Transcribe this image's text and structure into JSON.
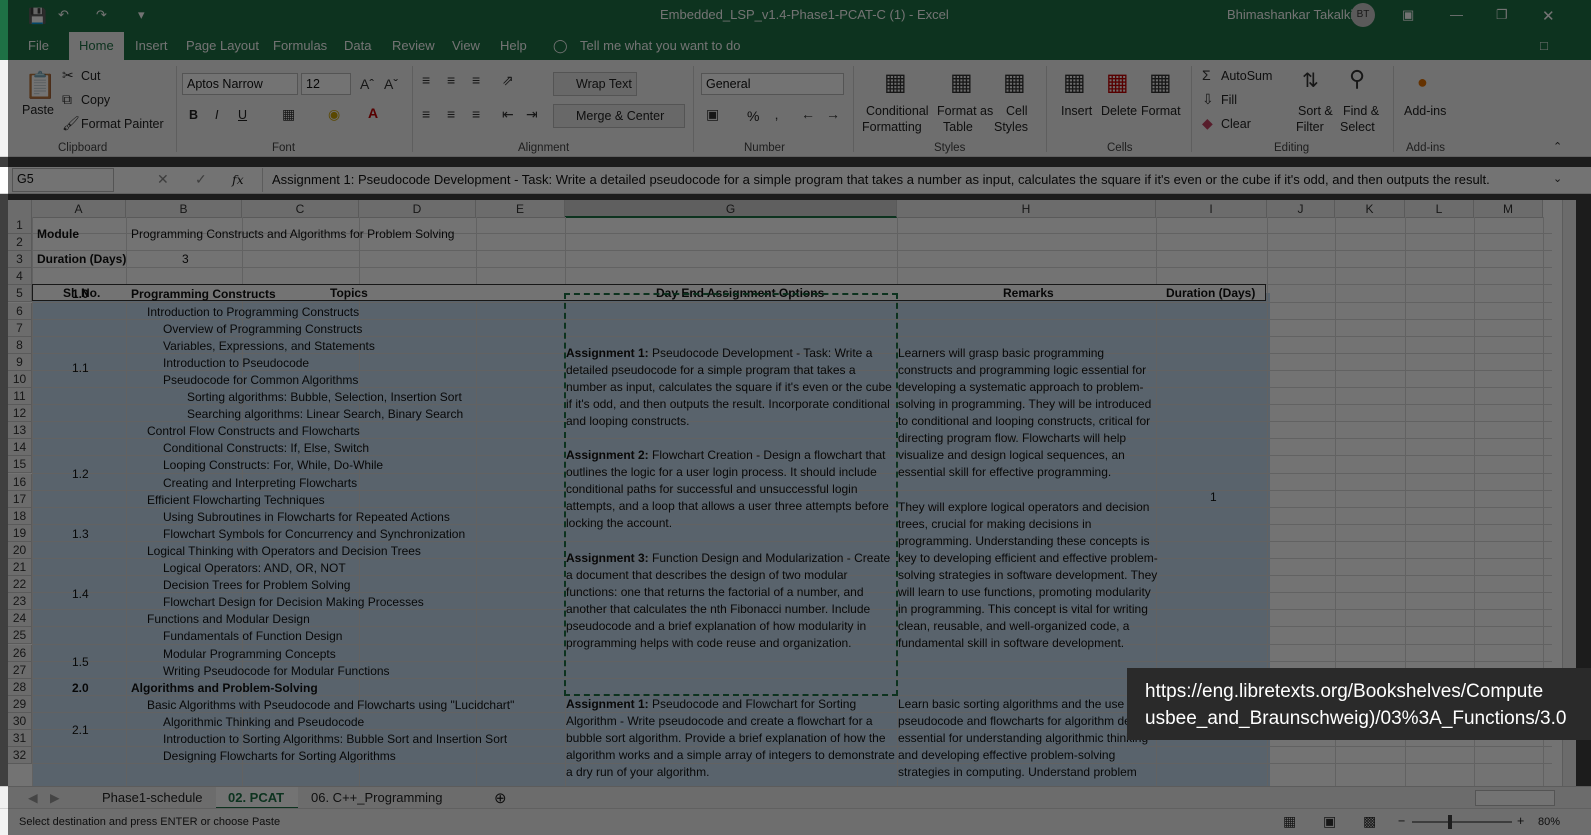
{
  "title_bar": {
    "doc_title": "Embedded_LSP_v1.4-Phase1-PCAT-C (1)  -  Excel",
    "user": "Bhimashankar Takalki",
    "initials": "BT"
  },
  "menu": {
    "file": "File",
    "home": "Home",
    "insert": "Insert",
    "page_layout": "Page Layout",
    "formulas": "Formulas",
    "data": "Data",
    "review": "Review",
    "view": "View",
    "help": "Help",
    "tell_me": "Tell me what you want to do"
  },
  "ribbon": {
    "clipboard": {
      "paste": "Paste",
      "cut": "Cut",
      "copy": "Copy",
      "format_painter": "Format Painter",
      "group": "Clipboard"
    },
    "font": {
      "name": "Aptos Narrow",
      "size": "12",
      "group": "Font",
      "bold": "B",
      "italic": "I",
      "underline": "U"
    },
    "alignment": {
      "wrap": "Wrap Text",
      "merge": "Merge & Center",
      "group": "Alignment"
    },
    "number": {
      "format": "General",
      "group": "Number",
      "percent": "%"
    },
    "styles": {
      "cond1": "Conditional",
      "cond2": "Formatting",
      "fmt1": "Format as",
      "fmt2": "Table",
      "cell1": "Cell",
      "cell2": "Styles",
      "group": "Styles"
    },
    "cells": {
      "insert": "Insert",
      "delete": "Delete",
      "format": "Format",
      "group": "Cells"
    },
    "editing": {
      "autosum": "AutoSum",
      "fill": "Fill",
      "clear": "Clear",
      "sort1": "Sort &",
      "sort2": "Filter",
      "find1": "Find &",
      "find2": "Select",
      "group": "Editing"
    },
    "addins": {
      "label": "Add-ins",
      "group": "Add-ins"
    }
  },
  "formula_bar": {
    "name_box": "G5",
    "fx": "fx",
    "content": "Assignment 1: Pseudocode Development - Task: Write a detailed pseudocode for a simple program that takes a number as input, calculates the square if it's even or the cube if it's odd, and then outputs the result."
  },
  "columns": [
    "A",
    "B",
    "C",
    "D",
    "E",
    "G",
    "H",
    "I",
    "J",
    "K",
    "L",
    "M"
  ],
  "rows": [
    "1",
    "2",
    "3",
    "4",
    "5",
    "6",
    "7",
    "8",
    "9",
    "10",
    "11",
    "12",
    "13",
    "14",
    "15",
    "16",
    "17",
    "18",
    "19",
    "20",
    "21",
    "22",
    "23",
    "24",
    "25",
    "26",
    "27",
    "28",
    "29",
    "30",
    "31",
    "32"
  ],
  "cells": {
    "module_label": "Module",
    "module_value": "Programming Constructs and Algorithms for Problem Solving",
    "duration_label": "Duration (Days)",
    "duration_value": "3",
    "h_slno": "Sl. No.",
    "h_topics": "Topics",
    "h_assign": "Day End Assignment Options",
    "h_remarks": "Remarks",
    "h_duration": "Duration (Days)",
    "duration_1": "1"
  },
  "sl_numbers": [
    "1.0",
    "1.1",
    "1.2",
    "1.3",
    "1.4",
    "1.5",
    "2.0",
    "2.1"
  ],
  "topics": [
    "Programming Constructs",
    "Introduction to Programming Constructs",
    "Overview of Programming Constructs",
    "Variables, Expressions, and Statements",
    "Introduction to Pseudocode",
    "Pseudocode for Common Algorithms",
    "Sorting algorithms: Bubble, Selection, Insertion Sort",
    "Searching algorithms: Linear Search, Binary Search",
    "Control Flow Constructs and Flowcharts",
    "Conditional Constructs: If, Else, Switch",
    "Looping Constructs: For, While, Do-While",
    "Creating and Interpreting Flowcharts",
    "Efficient Flowcharting Techniques",
    "Using Subroutines in Flowcharts for Repeated Actions",
    "Flowchart Symbols for Concurrency and Synchronization",
    "Logical Thinking with Operators and Decision Trees",
    "Logical Operators: AND, OR, NOT",
    "Decision Trees for Problem Solving",
    "Flowchart Design for Decision Making Processes",
    "Functions and Modular Design",
    "Fundamentals of Function Design",
    "Modular Programming Concepts",
    "Writing Pseudocode for Modular Functions",
    "Algorithms and Problem-Solving",
    "Basic Algorithms with Pseudocode and Flowcharts using \"Lucidchart\"",
    "Algorithmic Thinking and Pseudocode",
    "Introduction to Sorting Algorithms: Bubble Sort and Insertion Sort",
    "Designing Flowcharts for Sorting Algorithms"
  ],
  "assignments": {
    "a1_label": "Assignment 1:",
    "a1_text": "Pseudocode Development - Task: Write a detailed pseudocode for a simple program that takes a number as input, calculates the square if it's even or the cube if it's odd, and then outputs the result. Incorporate conditional and looping constructs.",
    "a2_label": "Assignment 2:",
    "a2_text": "Flowchart Creation - Design a flowchart that outlines the logic for a user login process. It should include conditional paths for successful and unsuccessful login attempts, and a loop that allows a user three attempts before locking the account.",
    "a3_label": "Assignment 3:",
    "a3_text": "Function Design and Modularization - Create a document that describes the design of two modular functions: one that returns the factorial of a number, and another that calculates the nth Fibonacci number. Include pseudocode and a brief explanation of how modularity in programming helps with code reuse and organization.",
    "b1_label": "Assignment 1:",
    "b1_text": "Pseudocode and Flowchart for Sorting Algorithm - Write pseudocode and create a flowchart for a bubble sort algorithm. Provide a brief explanation of how the algorithm works and a simple array of integers to demonstrate a dry run of your algorithm."
  },
  "remarks": {
    "r1": "Learners will grasp basic programming constructs and programming logic essential for developing a systematic approach to problem-solving in programming. They will be introduced to conditional and looping constructs, critical for directing program flow. Flowcharts will help visualize and design logical sequences, an essential skill for effective programming.",
    "r2": "They will explore logical operators and decision trees, crucial for making decisions in programming. Understanding these concepts is key to developing efficient and effective problem-solving strategies in software development. They will learn to use functions, promoting modularity in programming. This concept is vital for writing clean, reusable, and well-organized code, a fundamental skill in software development.",
    "r3": "Learn basic sorting algorithms and the use of pseudocode and flowcharts for algorithm design, essential for understanding algorithmic thinking and developing effective problem-solving strategies in computing. Understand problem"
  },
  "tooltip": {
    "line1": "https://eng.libretexts.org/Bookshelves/Compute",
    "line2": "usbee_and_Braunschweig)/03%3A_Functions/3.0"
  },
  "sheets": [
    "Phase1-schedule",
    "02. PCAT",
    "06. C++_Programming"
  ],
  "status": {
    "message": "Select destination and press ENTER or choose Paste",
    "zoom": "80%"
  }
}
